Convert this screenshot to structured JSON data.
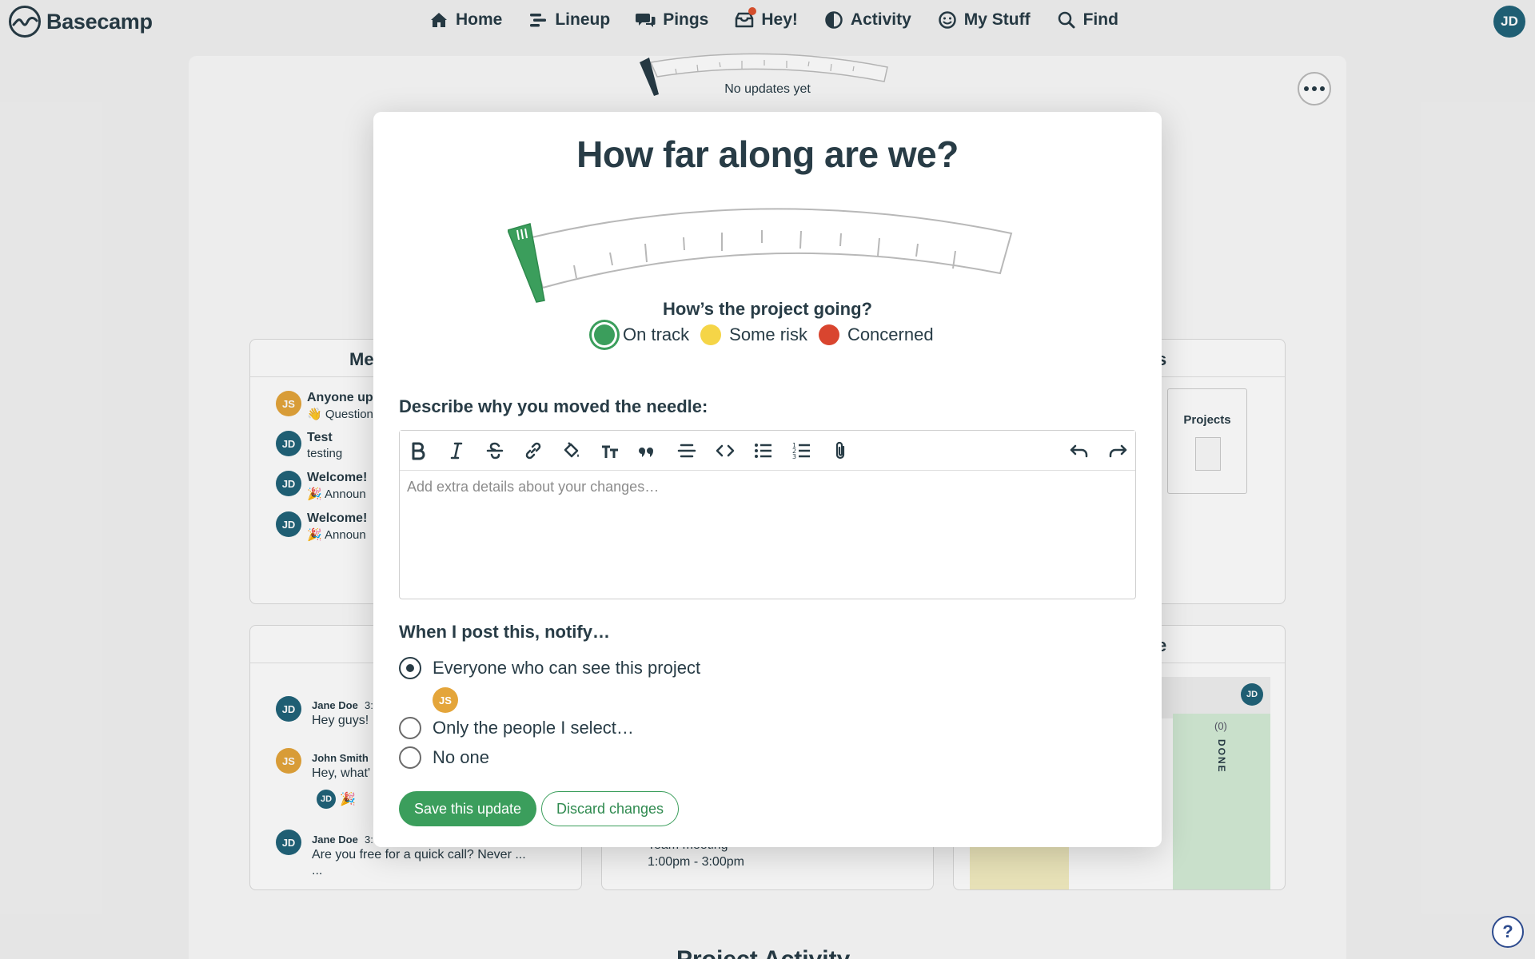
{
  "app": {
    "name": "Basecamp"
  },
  "nav": {
    "items": [
      {
        "label": "Home",
        "icon": "home-icon"
      },
      {
        "label": "Lineup",
        "icon": "lineup-icon"
      },
      {
        "label": "Pings",
        "icon": "pings-icon"
      },
      {
        "label": "Hey!",
        "icon": "hey-icon"
      },
      {
        "label": "Activity",
        "icon": "activity-icon"
      },
      {
        "label": "My Stuff",
        "icon": "smiley-icon"
      },
      {
        "label": "Find",
        "icon": "search-icon"
      }
    ],
    "user_initials": "JD"
  },
  "background": {
    "meter_status": "No updates yet",
    "message_board": {
      "title": "Me",
      "items": [
        {
          "initials": "JS",
          "title": "Anyone up",
          "sub": "👋 Question"
        },
        {
          "initials": "JD",
          "title": "Test",
          "sub": "testing"
        },
        {
          "initials": "JD",
          "title": "Welcome!",
          "sub": "🎉 Announ"
        },
        {
          "initials": "JD",
          "title": "Welcome!",
          "sub": "🎉 Announ"
        }
      ]
    },
    "docs": {
      "title": "s",
      "thumb_label": "Projects"
    },
    "chat": {
      "items": [
        {
          "initials": "JD",
          "name": "Jane Doe",
          "time": "3:",
          "text": "Hey guys!"
        },
        {
          "initials": "JS",
          "name": "John Smith",
          "time": "",
          "text": "Hey, what'"
        },
        {
          "initials": "JD",
          "name": "Jane Doe",
          "time": "3:",
          "text": "Are you free for a quick call? Never ...",
          "more": "..."
        }
      ],
      "boost_initials": "JD",
      "boost_emoji": "🎉"
    },
    "schedule": {
      "event": "Team meeting",
      "time": "1:00pm - 3:00pm"
    },
    "card_table": {
      "title": "e",
      "done_count": "(0)",
      "done_label": "DONE",
      "initials": "JD"
    },
    "activity_title": "Project Activity"
  },
  "modal": {
    "title": "How far along are we?",
    "progress_percent": 0,
    "going_label": "How’s the project going?",
    "statuses": [
      {
        "label": "On track",
        "color": "#3b9e5c",
        "selected": true
      },
      {
        "label": "Some risk",
        "color": "#f5d547",
        "selected": false
      },
      {
        "label": "Concerned",
        "color": "#d9452f",
        "selected": false
      }
    ],
    "describe_label": "Describe why you moved the needle:",
    "editor_placeholder": "Add extra details about your changes…",
    "toolbar": [
      "bold-icon",
      "italic-icon",
      "strikethrough-icon",
      "link-icon",
      "highlight-icon",
      "text-size-icon",
      "quote-icon",
      "divider-icon",
      "code-icon",
      "bullet-list-icon",
      "numbered-list-icon",
      "attachment-icon",
      "undo-icon",
      "redo-icon"
    ],
    "notify_label": "When I post this, notify…",
    "notify_options": [
      {
        "label": "Everyone who can see this project",
        "checked": true
      },
      {
        "label": "Only the people I select…",
        "checked": false
      },
      {
        "label": "No one",
        "checked": false
      }
    ],
    "everyone_initials": "JS",
    "save_label": "Save this update",
    "discard_label": "Discard changes"
  },
  "help_label": "?"
}
